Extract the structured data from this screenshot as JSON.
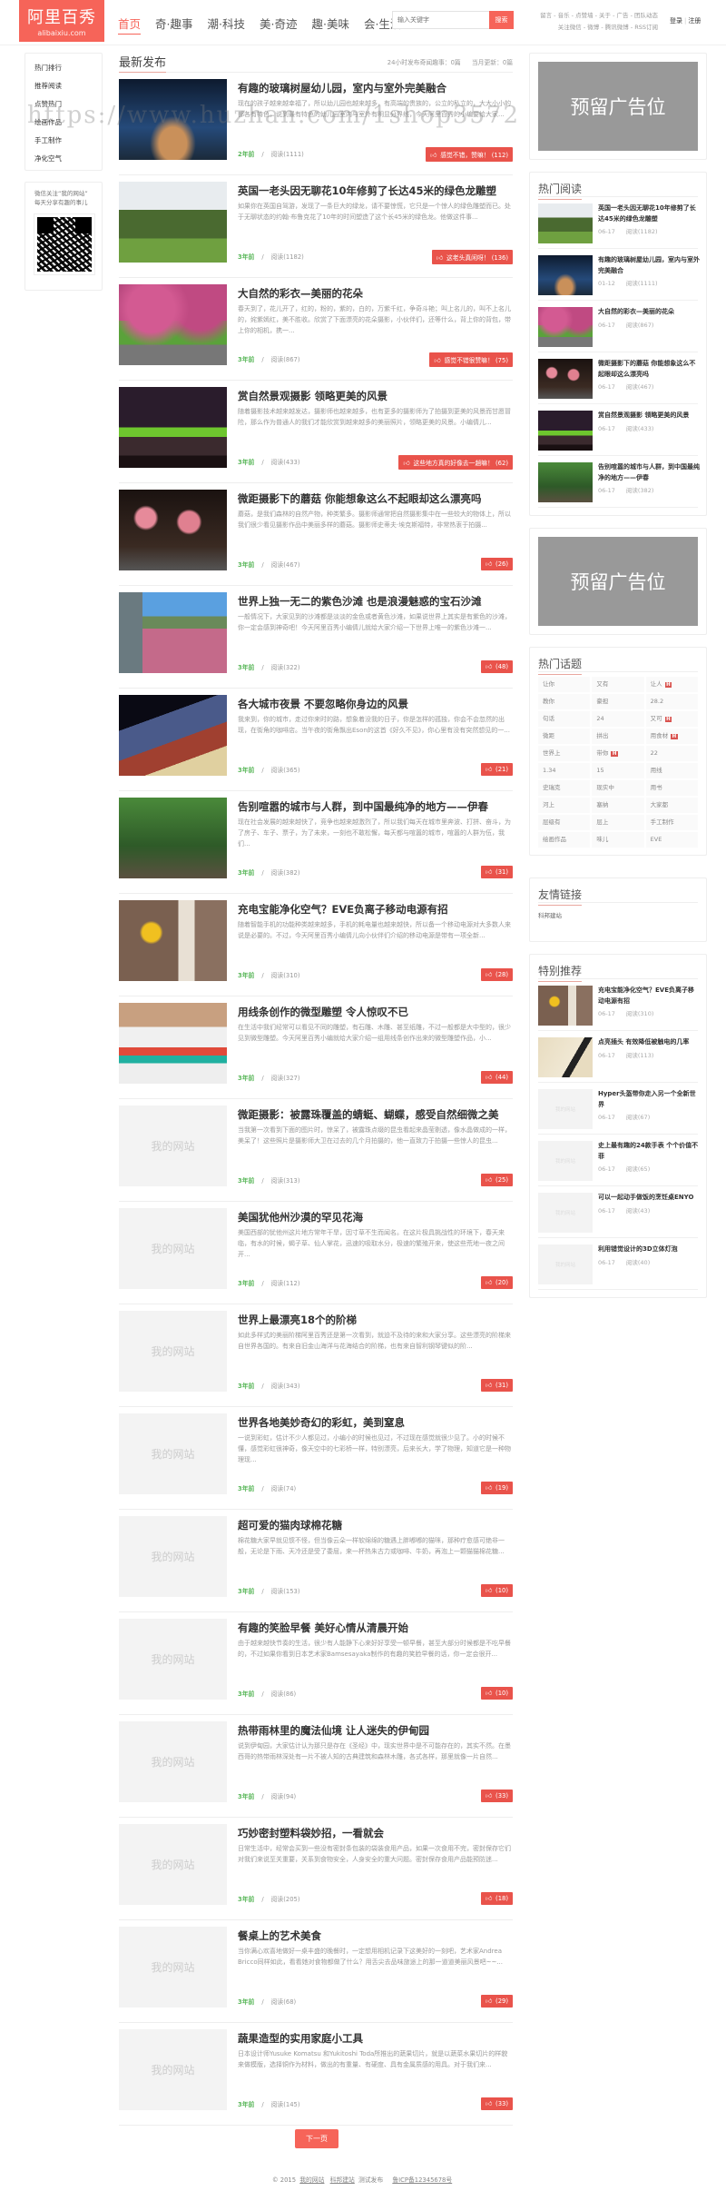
{
  "header": {
    "logo_title": "阿里百秀",
    "logo_domain": "alibaixiu.com",
    "nav": [
      "首页",
      "奇·趣事",
      "潮·科技",
      "美·奇迹",
      "趣·美味",
      "会·生活"
    ],
    "search_placeholder": "输入关键字",
    "search_button": "搜索",
    "toplinks_row1": "留言 - 音乐 - 点赞墙 - 关于 - 广告 - 团队动态",
    "toplinks_row2": "关注微信 - 微博 - 腾讯微博 - RSS订阅",
    "login": "登录",
    "divider": "|",
    "register": "注册"
  },
  "watermark": "https://www.huzhan.com/1shop3572",
  "left_sidebar": {
    "menu": [
      "热门排行",
      "推荐阅读",
      "点赞热门",
      "绘画作品",
      "手工制作",
      "净化空气"
    ],
    "wechat_line1": "微信关注“我的网站”",
    "wechat_line2": "每天分享有趣的事儿"
  },
  "main": {
    "heading": "最新发布",
    "stat_24h": "24小时发布奇闻趣事：0篇",
    "stat_month": "当月更新：0篇",
    "read_prefix": "阅读",
    "placeholder_text": "我的网站",
    "articles": [
      {
        "title": "有趣的玻璃树屋幼儿园，室内与室外完美融合",
        "excerpt": "现在的孩子越来越幸福了，所以幼儿园也越来越多，有高端的贵族的，公立的私立的，大大小小的都各有特色，说到最有特色的幼儿园室内与室外有明显分界线，今天阿里百秀的小编要给大家...",
        "time": "2年前",
        "reads": "阅读(1111)",
        "like": "感觉不错，赞嘛！ (112)",
        "photo": true
      },
      {
        "title": "英国一老头因无聊花10年修剪了长达45米的绿色龙雕塑",
        "excerpt": "如果你在英国自驾游，发现了一条巨大的绿龙，请不要惊慌，它只是一个惊人的绿色雕塑而已。处于无聊状态的约翰·布鲁克花了10年的时间塑造了这个长45米的绿色龙。他做这件事...",
        "time": "3年前",
        "reads": "阅读(1182)",
        "like": "这老头真闲呀！ (136)",
        "photo": true
      },
      {
        "title": "大自然的彩衣—美丽的花朵",
        "excerpt": "春天到了，花儿开了，红的，粉的，紫的，白的，万紫千红，争奇斗艳；叫上名儿的，叫不上名儿的，姹紫嫣红，美不胜收。欣赏了下面漂亮的花朵摄影，小伙伴们，还等什么，背上你的背包，带上你的相机，携一...",
        "time": "3年前",
        "reads": "阅读(867)",
        "like": "感觉不错很赞嘛！ (75)",
        "photo": true
      },
      {
        "title": "赏自然景观摄影 领略更美的风景",
        "excerpt": "随着摄影技术越来越发达，摄影师也越来越多，也有更多的摄影师为了拍摄到更美的风景而甘愿冒险，那么作为普通人的我们才能欣赏到越来越多的美丽照片，领略更美的风景。小编倩儿...",
        "time": "3年前",
        "reads": "阅读(433)",
        "like": "这些地方真的好像去一趟嘛！ (62)",
        "photo": true
      },
      {
        "title": "微距摄影下的蘑菇 你能想象这么不起眼却这么漂亮吗",
        "excerpt": "蘑菇，是我们森林的自然产物，种类繁多。摄影师通常把自然摄影集中在一些较大的物体上，所以我们很少看见摄影作品中美丽多样的蘑菇。摄影师史蒂夫·埃克斯福特，非常热衷于拍摄...",
        "time": "3年前",
        "reads": "阅读(467)",
        "like": "(26)",
        "photo": true
      },
      {
        "title": "世界上独一无二的紫色沙滩 也是浪漫魅惑的宝石沙滩",
        "excerpt": "一般情况下，大家见到的沙滩都是淡淡的金色或者黄色沙滩，如果说世界上其实是有紫色的沙滩，你一定会感到神奇吧！今天阿里百秀小编倩儿就给大家介绍一下世界上唯一的紫色沙滩一...",
        "time": "3年前",
        "reads": "阅读(322)",
        "like": "(48)",
        "photo": true
      },
      {
        "title": "各大城市夜景 不要忽略你身边的风景",
        "excerpt": "我来到，你的城市，走过你来时的路，想象着没我的日子，你是怎样的孤独，你会不会忽然的出现，在街角的咖啡店。当午夜的街角飘出Eson的这首《好久不见》，你心里有没有突然想见的一...",
        "time": "3年前",
        "reads": "阅读(365)",
        "like": "(21)",
        "photo": true
      },
      {
        "title": "告别喧嚣的城市与人群，到中国最纯净的地方——伊春",
        "excerpt": "现在社会发展的越来越快了，竞争也越来越激烈了，所以我们每天在城市里奔波、打拼、奋斗，为了房子、车子、票子，为了未来，一刻也不敢松懈，每天都与喧嚣的城市，喧嚣的人群为伍，我们...",
        "time": "3年前",
        "reads": "阅读(382)",
        "like": "(31)",
        "photo": true
      },
      {
        "title": "充电宝能净化空气？EVE负离子移动电源有招",
        "excerpt": "随着智能手机的功能种类越来越多，手机的耗电量也越来越快，所以备一个移动电源对大多数人来说是必要的。不过，今天阿里百秀小编倩儿向小伙伴们介绍的移动电源是带有一项全新...",
        "time": "3年前",
        "reads": "阅读(310)",
        "like": "(28)",
        "photo": true
      },
      {
        "title": "用线条创作的微型雕塑 令人惊叹不已",
        "excerpt": "在生活中我们经常可以看见不同的雕塑，有石雕、木雕、甚至纸雕，不过一般都是大中型的，很少见到微型雕塑。今天阿里百秀小编就给大家介绍一组用线条创作出来的微型雕塑作品，小...",
        "time": "3年前",
        "reads": "阅读(327)",
        "like": "(44)",
        "photo": true
      },
      {
        "title": "微距摄影：被露珠覆盖的蜻蜓、蝴蝶，感受自然细微之美",
        "excerpt": "当我第一次看到下面的图片时，惊呆了，被露珠点缀的昆虫看起来晶莹剔透，像水晶做成的一样，美呆了！这些照片是摄影师大卫在过去的几个月拍摄的，他一直致力于拍摄一些惊人的昆虫...",
        "time": "3年前",
        "reads": "阅读(313)",
        "like": "(25)",
        "photo": false
      },
      {
        "title": "美国犹他州沙漠的罕见花海",
        "excerpt": "美国西部的犹他州这片地方常年干旱，因寸草不生而闻名。在这片极具挑战性的环境下，春天来临，有水的时候，蝎子草、仙人掌花，迅速的吸取水分，极速的繁殖开来，使这些荒地一夜之间开...",
        "time": "3年前",
        "reads": "阅读(112)",
        "like": "(20)",
        "photo": false
      },
      {
        "title": "世界上最漂亮18个的阶梯",
        "excerpt": "如此多样式的美丽阶梯阿里百秀还是第一次看到，就迫不及待的来和大家分享。这些漂亮的阶梯来自世界各国的。有来自旧金山海洋与花海结合的阶梯，也有来自智利钢琴键似的阶...",
        "time": "3年前",
        "reads": "阅读(343)",
        "like": "(31)",
        "photo": false
      },
      {
        "title": "世界各地美妙奇幻的彩虹，美到窒息",
        "excerpt": "一说到彩虹，估计不少人都见过，小编小的时候也见过，不过现在感觉就很少见了。小的时候不懂，感觉彩虹很神奇，像天空中的七彩桥一样，特别漂亮，后来长大，学了物理，知道它是一种物理现...",
        "time": "3年前",
        "reads": "阅读(74)",
        "like": "(19)",
        "photo": false
      },
      {
        "title": "超可爱的猫肉球棉花糖",
        "excerpt": "棉花糖大家早就见惯不怪，但当像云朵一样软绵绵的糖遇上胖嘟嘟的猫咪，那种疗愈感可绝非一般，无论是下雨、天冷还是受了委屈，来一杯热朱古力或咖啡、牛奶，再泡上一颗猫猫棉花糖...",
        "time": "3年前",
        "reads": "阅读(153)",
        "like": "(10)",
        "photo": false
      },
      {
        "title": "有趣的笑脸早餐 美好心情从清晨开始",
        "excerpt": "由于越来越快节奏的生活，很少有人能静下心来好好享受一顿早餐，甚至大部分时候都是不吃早餐的，不过如果你看到日本艺术家Bamsesayaka制作的有趣的笑脸早餐的话，你一定会很开...",
        "time": "3年前",
        "reads": "阅读(86)",
        "like": "(10)",
        "photo": false
      },
      {
        "title": "热带雨林里的魔法仙境 让人迷失的伊甸园",
        "excerpt": "说到伊甸园，大家估计认为那只是存在《圣经》中，现实世界中是不可能存在的，其实不然。在墨西哥的热带雨林深处有一片不被人知的古典建筑和森林木雕，各式各样，那里就像一片自然...",
        "time": "3年前",
        "reads": "阅读(94)",
        "like": "(33)",
        "photo": false
      },
      {
        "title": "巧妙密封塑料袋妙招，一看就会",
        "excerpt": "日常生活中，经常会买到一些没有密封条包装的袋装食用产品，如果一次食用不完，密封保存它们对我们来说至关重要，关系到食物安全，人身安全的重大问题。密封保存食用产品能预防迷...",
        "time": "3年前",
        "reads": "阅读(205)",
        "like": "(18)",
        "photo": false
      },
      {
        "title": "餐桌上的艺术美食",
        "excerpt": "当你满心欢喜地做好一桌丰盛的晚餐时，一定想用相机记录下这美好的一刻吧，艺术家Andrea Bricco同样如此，看看她对食物都做了什么？用舌尖去品味旅途上的那一道道美丽风景吧~~...",
        "time": "3年前",
        "reads": "阅读(68)",
        "like": "(29)",
        "photo": false
      },
      {
        "title": "蔬果造型的实用家庭小工具",
        "excerpt": "日本设计师Yusuke Komatsu 和Yukitoshi Toda所推出的蔬果切片，就是以蔬菜水果切片的样貌来做模版，选择铜作为材料，做出的有重量、有硬度、具有金属质感的用具。对于我们来...",
        "time": "3年前",
        "reads": "阅读(145)",
        "like": "(33)",
        "photo": false
      }
    ],
    "next_page": "下一页"
  },
  "right_sidebar": {
    "ad_text": "预留广告位",
    "hot_read_title": "热门阅读",
    "hot_read": [
      {
        "title": "英国一老头因无聊花10年修剪了长达45米的绿色龙雕塑",
        "date": "06-17",
        "reads": "阅读(1182)",
        "img": 1
      },
      {
        "title": "有趣的玻璃树屋幼儿园，室内与室外完美融合",
        "date": "01-12",
        "reads": "阅读(1111)",
        "img": 0
      },
      {
        "title": "大自然的彩衣—美丽的花朵",
        "date": "06-17",
        "reads": "阅读(867)",
        "img": 2
      },
      {
        "title": "微距摄影下的蘑菇 你能想象这么不起眼却这么漂亮吗",
        "date": "06-17",
        "reads": "阅读(467)",
        "img": 4
      },
      {
        "title": "赏自然景观摄影 领略更美的风景",
        "date": "06-17",
        "reads": "阅读(433)",
        "img": 3
      },
      {
        "title": "告别喧嚣的城市与人群，到中国最纯净的地方——伊春",
        "date": "06-17",
        "reads": "阅读(382)",
        "img": 7
      }
    ],
    "hot_topics_title": "热门话题",
    "hot_badge": "H",
    "hot_topics": [
      {
        "t": "让你"
      },
      {
        "t": "又有"
      },
      {
        "t": "让人",
        "hot": true
      },
      {
        "t": "教你"
      },
      {
        "t": "豪担"
      },
      {
        "t": "28.2"
      },
      {
        "t": "句话"
      },
      {
        "t": "24"
      },
      {
        "t": "又可",
        "hot": true
      },
      {
        "t": "微距"
      },
      {
        "t": "拼出"
      },
      {
        "t": "用食材",
        "hot": true
      },
      {
        "t": "世界上"
      },
      {
        "t": "带你",
        "hot": true
      },
      {
        "t": "22"
      },
      {
        "t": "1.34"
      },
      {
        "t": "15"
      },
      {
        "t": "用线"
      },
      {
        "t": "史瑞克"
      },
      {
        "t": "现实中"
      },
      {
        "t": "用书"
      },
      {
        "t": "河上"
      },
      {
        "t": "塞纳"
      },
      {
        "t": "大家都"
      },
      {
        "t": "层级有"
      },
      {
        "t": "层上"
      },
      {
        "t": "手工制作"
      },
      {
        "t": "绘画作品"
      },
      {
        "t": "味儿"
      },
      {
        "t": "EVE"
      }
    ],
    "links_title": "友情链接",
    "links": [
      "科邦建站"
    ],
    "special_title": "特别推荐",
    "special": [
      {
        "title": "充电宝能净化空气？EVE负离子移动电源有招",
        "date": "06-17",
        "reads": "阅读(310)",
        "img": 8
      },
      {
        "title": "点亮插头 有效降低被触电的几率",
        "date": "06-17",
        "reads": "阅读(113)",
        "img": 10
      },
      {
        "title": "Hyper头盔带你走入另一个全新世界",
        "date": "06-17",
        "reads": "阅读(67)",
        "img": null
      },
      {
        "title": "史上最有趣的24款手表 个个价值不菲",
        "date": "06-17",
        "reads": "阅读(65)",
        "img": null
      },
      {
        "title": "可以一起动手做饭的烹饪桌ENYO",
        "date": "06-17",
        "reads": "阅读(43)",
        "img": null
      },
      {
        "title": "利用错觉设计的3D立体灯泡",
        "date": "06-17",
        "reads": "阅读(40)",
        "img": null
      }
    ]
  },
  "footer": {
    "copyright": "© 2015",
    "site": "我的网站",
    "builder": "科邦建站",
    "note": "测试发布",
    "icp": "鲁ICP备12345678号"
  },
  "colors": {
    "accent": "#f66459",
    "like": "#e9534b",
    "time": "#5cb85c",
    "ad": "#999999"
  }
}
